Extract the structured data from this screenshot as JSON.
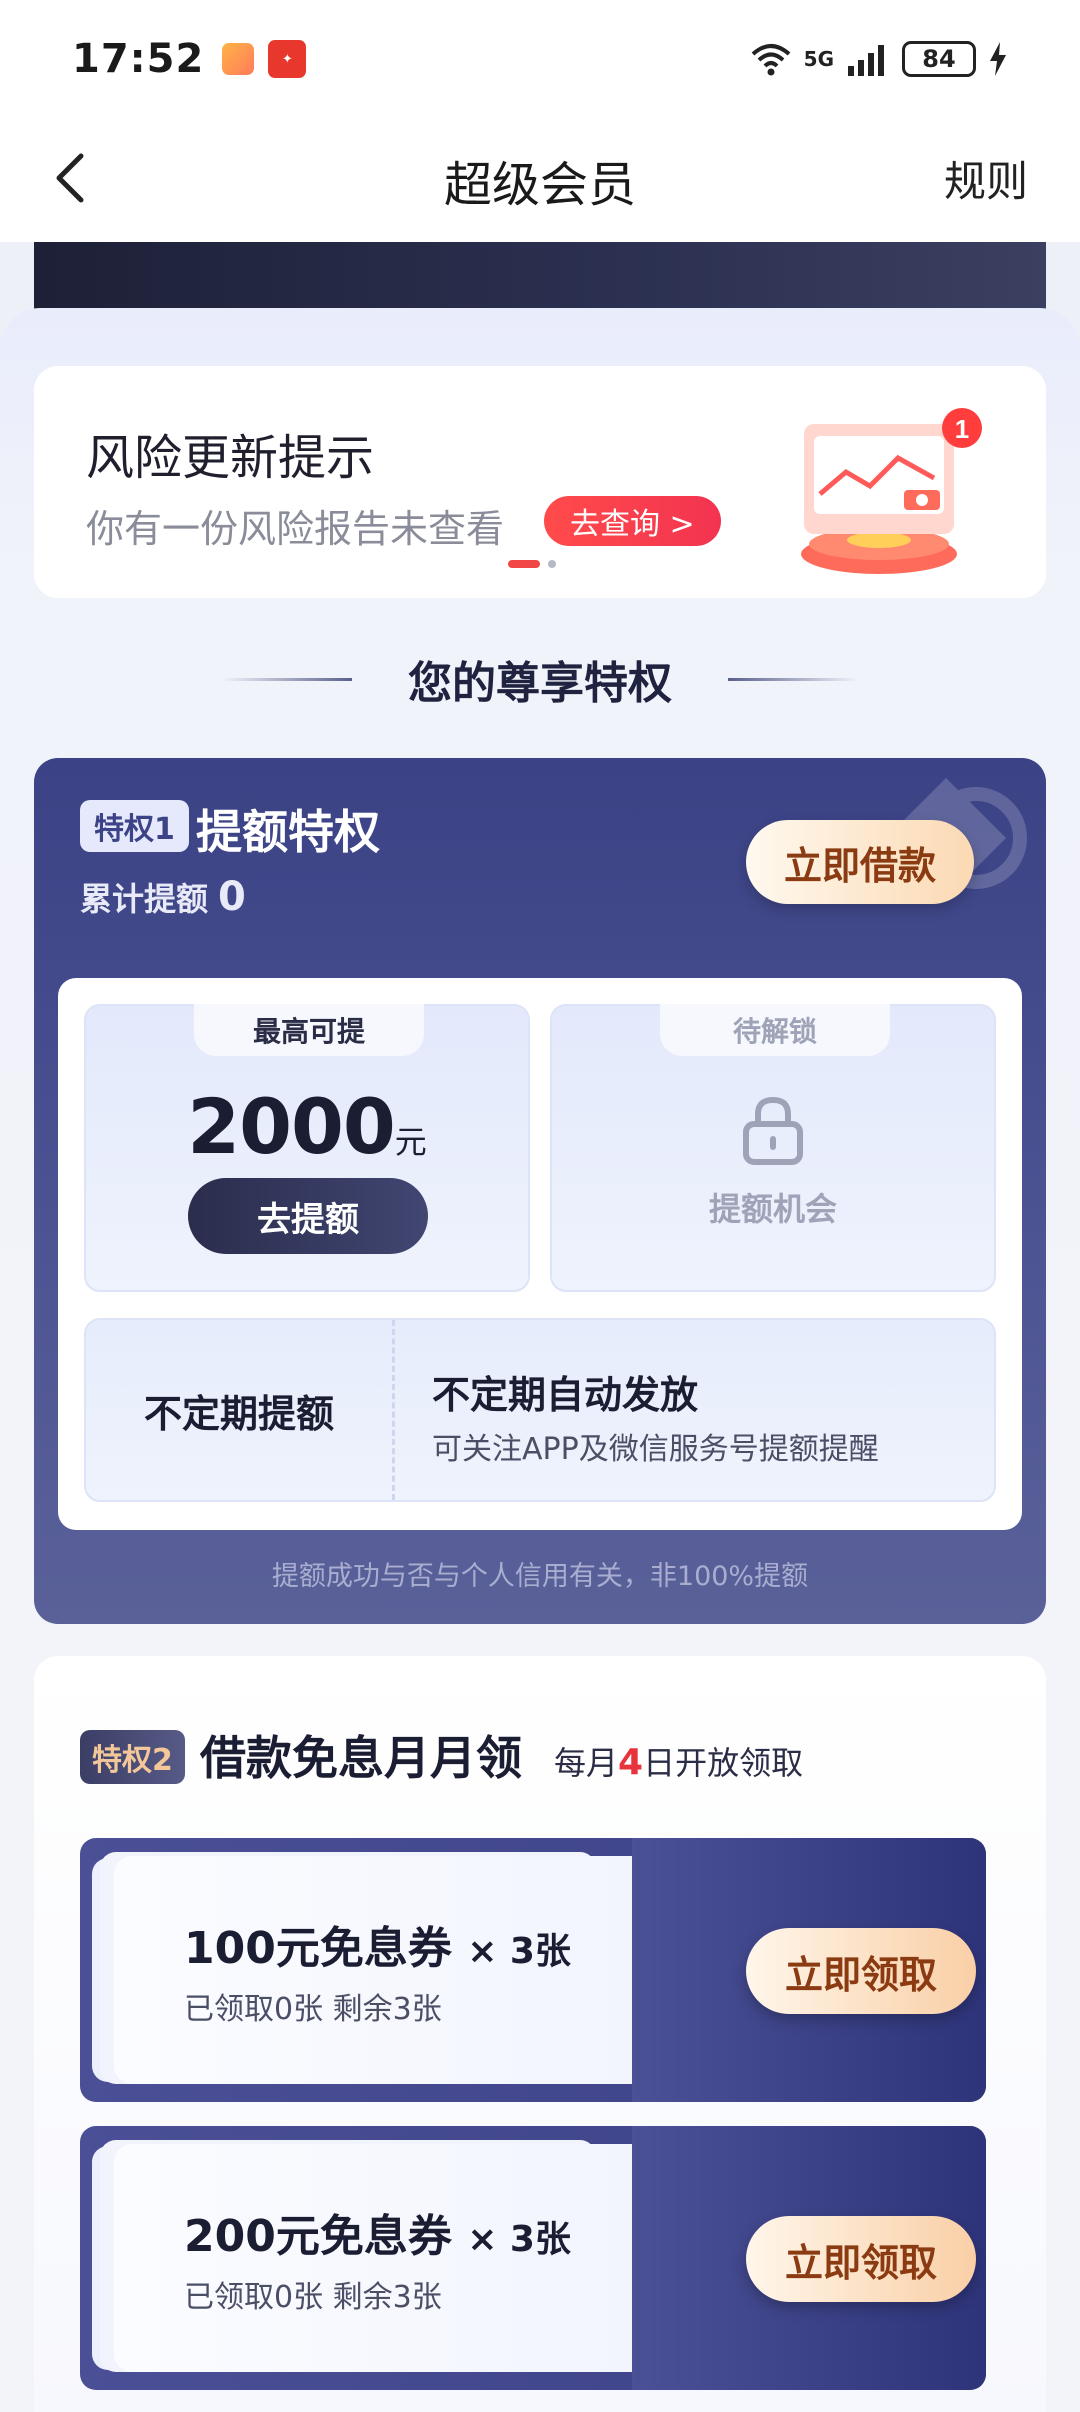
{
  "status_bar": {
    "time": "17:52",
    "network": "5G",
    "battery": "84"
  },
  "nav": {
    "title": "超级会员",
    "rules": "规则"
  },
  "risk_card": {
    "title": "风险更新提示",
    "subtitle": "你有一份风险报告未查看",
    "button": "去查询 >",
    "badge": "1"
  },
  "section": {
    "heading": "您的尊享特权"
  },
  "privilege1": {
    "tag": "特权1",
    "title": "提额特权",
    "cumulative_label": "累计提额",
    "cumulative_value": "0",
    "borrow_button": "立即借款",
    "ticket_left": {
      "tab": "最高可提",
      "amount": "2000",
      "unit": "元",
      "button": "去提额"
    },
    "ticket_right": {
      "tab": "待解锁",
      "label": "提额机会"
    },
    "irregular": {
      "left": "不定期提额",
      "title": "不定期自动发放",
      "subtitle": "可关注APP及微信服务号提额提醒"
    },
    "note": "提额成功与否与个人信用有关，非100%提额"
  },
  "privilege2": {
    "tag": "特权2",
    "title": "借款免息月月领",
    "sub_prefix": "每月",
    "sub_highlight": "4",
    "sub_suffix": "日开放领取",
    "coupons": [
      {
        "name": "100元免息券",
        "times": "× 3张",
        "status": "已领取0张 剩余3张",
        "button": "立即领取"
      },
      {
        "name": "200元免息券",
        "times": "× 3张",
        "status": "已领取0张 剩余3张",
        "button": "立即领取"
      }
    ]
  },
  "colors": {
    "accent_red": "#f04646",
    "privilege_blue": "#3b4285",
    "gold_button": "#fbd9b3"
  }
}
